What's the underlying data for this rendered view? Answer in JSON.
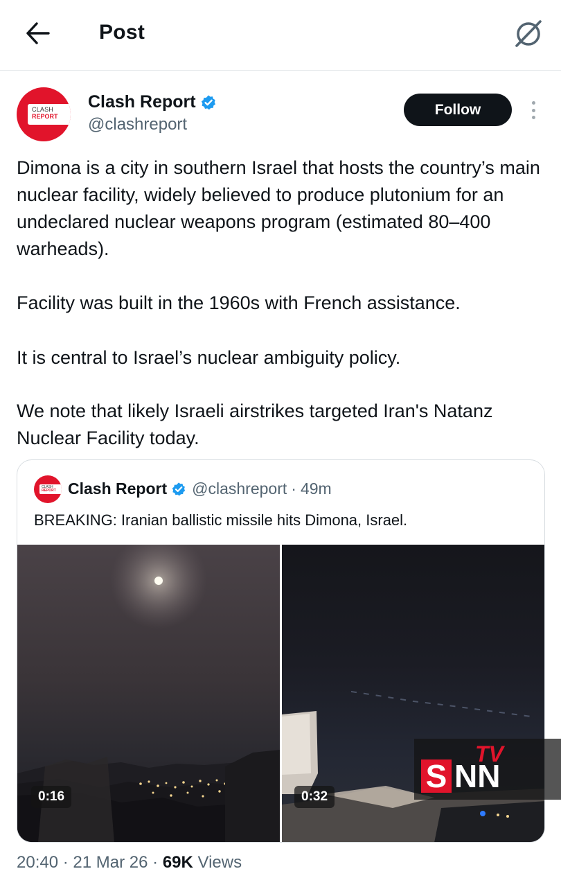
{
  "header": {
    "title": "Post"
  },
  "author": {
    "name": "Clash Report",
    "handle": "@clashreport",
    "avatar_text_top": "CLASH",
    "avatar_text_bottom": "REPORT",
    "follow_label": "Follow"
  },
  "post": {
    "paragraphs": [
      "Dimona is a city in southern Israel that hosts the country’s main nuclear facility, widely believed to produce plutonium for an undeclared nuclear weapons program (estimated 80–400 warheads).",
      "Facility was built in the 1960s with French assistance.",
      "It is central to Israel’s nuclear ambiguity policy.",
      "We note that likely Israeli airstrikes targeted Iran's Natanz Nuclear Facility today."
    ]
  },
  "quote": {
    "name": "Clash Report",
    "handle": "@clashreport",
    "separator": "·",
    "time": "49m",
    "text": "BREAKING: Iranian ballistic missile hits Dimona, Israel.",
    "videos": [
      {
        "duration": "0:16"
      },
      {
        "duration": "0:32"
      }
    ]
  },
  "watermark": {
    "tv": "TV",
    "s": "S",
    "nn": "NN"
  },
  "meta": {
    "time": "20:40",
    "sep1": "·",
    "date": "21 Mar 26",
    "sep2": "·",
    "views_count": "69K",
    "views_label": "Views"
  },
  "colors": {
    "verified": "#1d9bf0",
    "brand_red": "#e1142b",
    "follow_bg": "#0f1419"
  }
}
